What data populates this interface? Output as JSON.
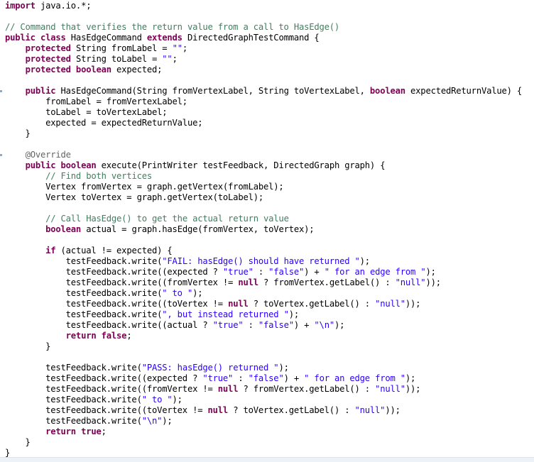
{
  "editor": {
    "language": "java",
    "lines": [
      [
        [
          "kw",
          "import"
        ],
        [
          "t",
          " java.io.*;"
        ]
      ],
      [],
      [
        [
          "cm",
          "// Command that verifies the return value from a call to HasEdge()"
        ]
      ],
      [
        [
          "kw",
          "public class"
        ],
        [
          "t",
          " HasEdgeCommand "
        ],
        [
          "kw",
          "extends"
        ],
        [
          "t",
          " DirectedGraphTestCommand {"
        ]
      ],
      [
        [
          "t",
          "    "
        ],
        [
          "kw",
          "protected"
        ],
        [
          "t",
          " String fromLabel = "
        ],
        [
          "str",
          "\"\""
        ],
        [
          "t",
          ";"
        ]
      ],
      [
        [
          "t",
          "    "
        ],
        [
          "kw",
          "protected"
        ],
        [
          "t",
          " String toLabel = "
        ],
        [
          "str",
          "\"\""
        ],
        [
          "t",
          ";"
        ]
      ],
      [
        [
          "t",
          "    "
        ],
        [
          "kw",
          "protected boolean"
        ],
        [
          "t",
          " expected;"
        ]
      ],
      [],
      [
        [
          "t",
          "    "
        ],
        [
          "kw",
          "public"
        ],
        [
          "t",
          " HasEdgeCommand(String fromVertexLabel, String toVertexLabel, "
        ],
        [
          "kw",
          "boolean"
        ],
        [
          "t",
          " expectedReturnValue) {"
        ]
      ],
      [
        [
          "t",
          "        fromLabel = fromVertexLabel;"
        ]
      ],
      [
        [
          "t",
          "        toLabel = toVertexLabel;"
        ]
      ],
      [
        [
          "t",
          "        expected = expectedReturnValue;"
        ]
      ],
      [
        [
          "t",
          "    }"
        ]
      ],
      [],
      [
        [
          "t",
          "    "
        ],
        [
          "ann",
          "@Override"
        ]
      ],
      [
        [
          "t",
          "    "
        ],
        [
          "kw",
          "public boolean"
        ],
        [
          "t",
          " execute(PrintWriter testFeedback, DirectedGraph graph) {"
        ]
      ],
      [
        [
          "t",
          "        "
        ],
        [
          "cm",
          "// Find both vertices"
        ]
      ],
      [
        [
          "t",
          "        Vertex fromVertex = graph.getVertex(fromLabel);"
        ]
      ],
      [
        [
          "t",
          "        Vertex toVertex = graph.getVertex(toLabel);"
        ]
      ],
      [],
      [
        [
          "t",
          "        "
        ],
        [
          "cm",
          "// Call HasEdge() to get the actual return value"
        ]
      ],
      [
        [
          "t",
          "        "
        ],
        [
          "kw",
          "boolean"
        ],
        [
          "t",
          " actual = graph.hasEdge(fromVertex, toVertex);"
        ]
      ],
      [],
      [
        [
          "t",
          "        "
        ],
        [
          "kw",
          "if"
        ],
        [
          "t",
          " (actual != expected) {"
        ]
      ],
      [
        [
          "t",
          "            testFeedback.write("
        ],
        [
          "str",
          "\"FAIL: hasEdge() should have returned \""
        ],
        [
          "t",
          ");"
        ]
      ],
      [
        [
          "t",
          "            testFeedback.write((expected ? "
        ],
        [
          "str",
          "\"true\""
        ],
        [
          "t",
          " : "
        ],
        [
          "str",
          "\"false\""
        ],
        [
          "t",
          ") + "
        ],
        [
          "str",
          "\" for an edge from \""
        ],
        [
          "t",
          ");"
        ]
      ],
      [
        [
          "t",
          "            testFeedback.write((fromVertex != "
        ],
        [
          "kw",
          "null"
        ],
        [
          "t",
          " ? fromVertex.getLabel() : "
        ],
        [
          "str",
          "\"null\""
        ],
        [
          "t",
          "));"
        ]
      ],
      [
        [
          "t",
          "            testFeedback.write("
        ],
        [
          "str",
          "\" to \""
        ],
        [
          "t",
          ");"
        ]
      ],
      [
        [
          "t",
          "            testFeedback.write((toVertex != "
        ],
        [
          "kw",
          "null"
        ],
        [
          "t",
          " ? toVertex.getLabel() : "
        ],
        [
          "str",
          "\"null\""
        ],
        [
          "t",
          "));"
        ]
      ],
      [
        [
          "t",
          "            testFeedback.write("
        ],
        [
          "str",
          "\", but instead returned \""
        ],
        [
          "t",
          ");"
        ]
      ],
      [
        [
          "t",
          "            testFeedback.write((actual ? "
        ],
        [
          "str",
          "\"true\""
        ],
        [
          "t",
          " : "
        ],
        [
          "str",
          "\"false\""
        ],
        [
          "t",
          ") + "
        ],
        [
          "str",
          "\"\\n\""
        ],
        [
          "t",
          ");"
        ]
      ],
      [
        [
          "t",
          "            "
        ],
        [
          "kw",
          "return false"
        ],
        [
          "t",
          ";"
        ]
      ],
      [
        [
          "t",
          "        }"
        ]
      ],
      [],
      [
        [
          "t",
          "        testFeedback.write("
        ],
        [
          "str",
          "\"PASS: hasEdge() returned \""
        ],
        [
          "t",
          ");"
        ]
      ],
      [
        [
          "t",
          "        testFeedback.write((expected ? "
        ],
        [
          "str",
          "\"true\""
        ],
        [
          "t",
          " : "
        ],
        [
          "str",
          "\"false\""
        ],
        [
          "t",
          ") + "
        ],
        [
          "str",
          "\" for an edge from \""
        ],
        [
          "t",
          ");"
        ]
      ],
      [
        [
          "t",
          "        testFeedback.write((fromVertex != "
        ],
        [
          "kw",
          "null"
        ],
        [
          "t",
          " ? fromVertex.getLabel() : "
        ],
        [
          "str",
          "\"null\""
        ],
        [
          "t",
          "));"
        ]
      ],
      [
        [
          "t",
          "        testFeedback.write("
        ],
        [
          "str",
          "\" to \""
        ],
        [
          "t",
          ");"
        ]
      ],
      [
        [
          "t",
          "        testFeedback.write((toVertex != "
        ],
        [
          "kw",
          "null"
        ],
        [
          "t",
          " ? toVertex.getLabel() : "
        ],
        [
          "str",
          "\"null\""
        ],
        [
          "t",
          "));"
        ]
      ],
      [
        [
          "t",
          "        testFeedback.write("
        ],
        [
          "str",
          "\"\\n\""
        ],
        [
          "t",
          ");"
        ]
      ],
      [
        [
          "t",
          "        "
        ],
        [
          "kw",
          "return true"
        ],
        [
          "t",
          ";"
        ]
      ],
      [
        [
          "t",
          "    }"
        ]
      ],
      [
        [
          "t",
          "}"
        ]
      ]
    ],
    "fold_marker_lines": [
      8,
      14
    ],
    "colors": {
      "keyword": "#7f0055",
      "string": "#2a00ff",
      "comment": "#3f7f5f",
      "annotation": "#646464",
      "plain": "#000000"
    }
  }
}
